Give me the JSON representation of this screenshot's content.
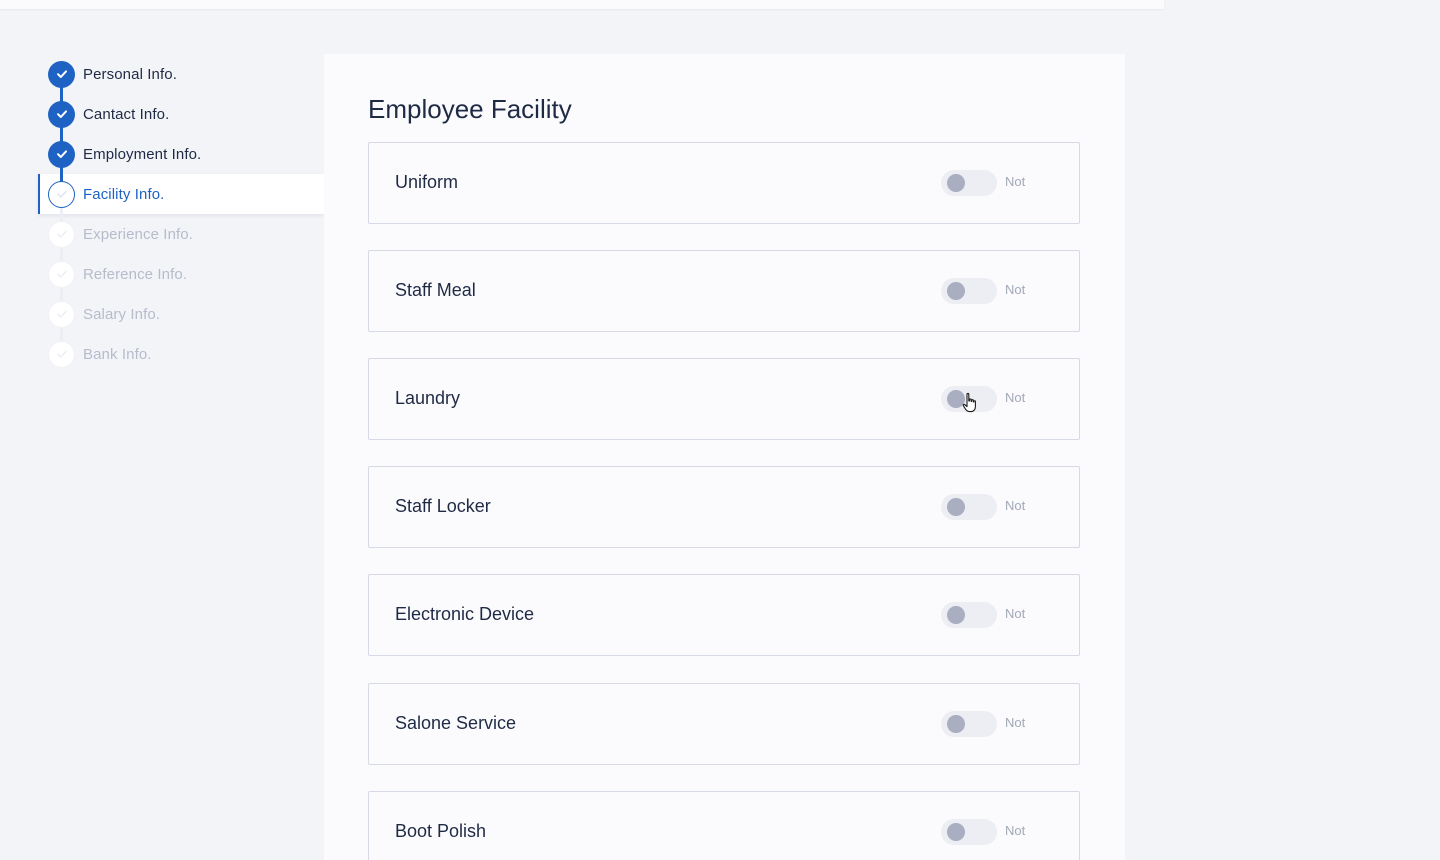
{
  "steps": [
    {
      "label": "Personal Info.",
      "status": "done"
    },
    {
      "label": "Cantact Info.",
      "status": "done"
    },
    {
      "label": "Employment Info.",
      "status": "done"
    },
    {
      "label": "Facility Info.",
      "status": "active"
    },
    {
      "label": "Experience Info.",
      "status": "pending"
    },
    {
      "label": "Reference Info.",
      "status": "pending"
    },
    {
      "label": "Salary Info.",
      "status": "pending"
    },
    {
      "label": "Bank Info.",
      "status": "pending"
    }
  ],
  "main": {
    "title": "Employee Facility",
    "facilities": [
      {
        "name": "Uniform",
        "state": "Not",
        "enabled": false
      },
      {
        "name": "Staff Meal",
        "state": "Not",
        "enabled": false
      },
      {
        "name": "Laundry",
        "state": "Not",
        "enabled": false
      },
      {
        "name": "Staff Locker",
        "state": "Not",
        "enabled": false
      },
      {
        "name": "Electronic Device",
        "state": "Not",
        "enabled": false
      },
      {
        "name": "Salone Service",
        "state": "Not",
        "enabled": false
      },
      {
        "name": "Boot Polish",
        "state": "Not",
        "enabled": false
      }
    ]
  },
  "colors": {
    "accent": "#1e63c4",
    "background": "#f3f4f8",
    "panel": "#fbfbfd",
    "pending_text": "#b6bccb"
  },
  "icons": {
    "step_check": "check-icon",
    "cursor": "hand-pointer-icon"
  }
}
